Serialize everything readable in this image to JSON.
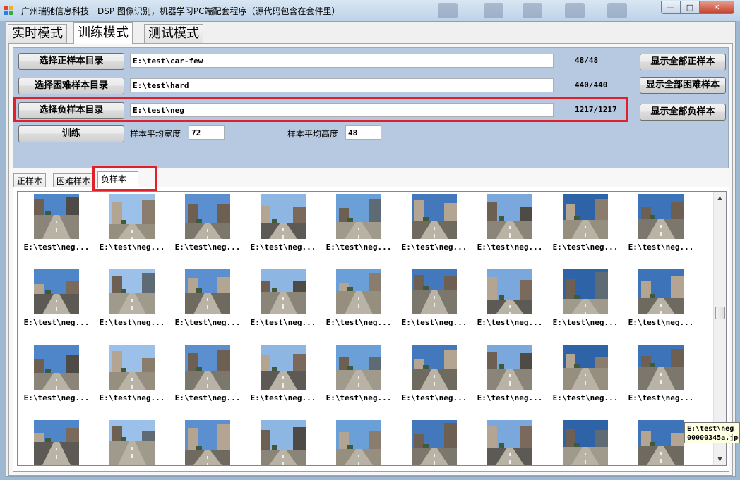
{
  "window": {
    "title": "广州瑞驰信息科技　DSP 图像识别，机器学习PC端配套程序（源代码包含在套件里）",
    "buttons": {
      "minimize": "—",
      "maximize": "□",
      "close": "✕"
    }
  },
  "main_tabs": [
    {
      "label": "实时模式"
    },
    {
      "label": "训练模式"
    },
    {
      "label": "测试模式"
    }
  ],
  "sample_rows": {
    "positive": {
      "select_label": "选择正样本目录",
      "path": "E:\\test\\car-few",
      "count": "48/48",
      "show_label": "显示全部正样本"
    },
    "hard": {
      "select_label": "选择困难样本目录",
      "path": "E:\\test\\hard",
      "count": "440/440",
      "show_label": "显示全部困难样本"
    },
    "negative": {
      "select_label": "选择负样本目录",
      "path": "E:\\test\\neg",
      "count": "1217/1217",
      "show_label": "显示全部负样本"
    }
  },
  "train": {
    "button_label": "训练",
    "avg_width_label": "样本平均宽度",
    "avg_width_value": "72",
    "avg_height_label": "样本平均高度",
    "avg_height_value": "48"
  },
  "sub_tabs": [
    {
      "label": "正样本"
    },
    {
      "label": "困难样本"
    },
    {
      "label": "负样本"
    }
  ],
  "thumbnails": {
    "caption": "E:\\test\\neg...",
    "rows": 4,
    "cols": 9
  },
  "tooltip": {
    "line1": "E:\\test\\neg",
    "line2": "00000345a.jpg"
  },
  "colors": {
    "highlight_red": "#e0202a",
    "panel_blue": "#b7c9e0"
  }
}
